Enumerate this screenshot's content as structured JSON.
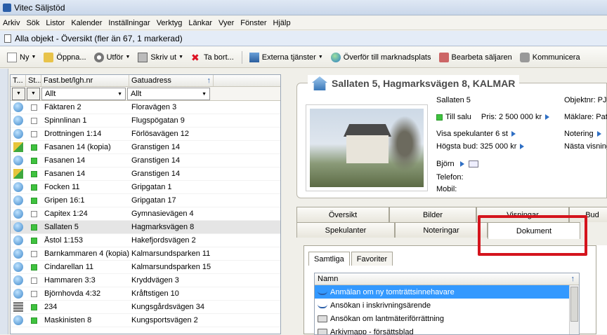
{
  "window": {
    "title": "Vitec Säljstöd"
  },
  "menu": [
    "Arkiv",
    "Sök",
    "Listor",
    "Kalender",
    "Inställningar",
    "Verktyg",
    "Länkar",
    "Vyer",
    "Fönster",
    "Hjälp"
  ],
  "object_bar": {
    "title": "Alla objekt - Översikt (fler än 67, 1 markerad)"
  },
  "toolbar": {
    "new": "Ny",
    "open": "Öppna...",
    "perform": "Utför",
    "print": "Skriv ut",
    "delete": "Ta bort...",
    "external": "Externa tjänster",
    "transfer": "Överför till marknadsplats",
    "edit_seller": "Bearbeta säljaren",
    "communicate": "Kommunicera"
  },
  "grid": {
    "headers": [
      "T...",
      "St...",
      "Fast.bet/lgh.nr",
      "Gatuadress"
    ],
    "filter_all": "Allt",
    "filter_all2": "Allt",
    "rows": [
      {
        "name": "Fäktaren 2",
        "addr": "Floravägen 3",
        "icon": "globe",
        "status": "none"
      },
      {
        "name": "Spinnlinan 1",
        "addr": "Flugspögatan 9",
        "icon": "globe",
        "status": "none"
      },
      {
        "name": "Drottningen 1:14",
        "addr": "Förlösavägen 12",
        "icon": "globe",
        "status": "none"
      },
      {
        "name": "Fasanen 14 (kopia)",
        "addr": "Granstigen 14",
        "icon": "alt",
        "status": "green"
      },
      {
        "name": "Fasanen 14",
        "addr": "Granstigen 14",
        "icon": "globe",
        "status": "green"
      },
      {
        "name": "Fasanen 14",
        "addr": "Granstigen 14",
        "icon": "alt",
        "status": "green"
      },
      {
        "name": "Focken 11",
        "addr": "Gripgatan 1",
        "icon": "globe",
        "status": "green"
      },
      {
        "name": "Gripen 16:1",
        "addr": "Gripgatan 17",
        "icon": "globe",
        "status": "green"
      },
      {
        "name": "Capitex 1:24",
        "addr": "Gymnasievägen 4",
        "icon": "globe",
        "status": "none"
      },
      {
        "name": "Sallaten 5",
        "addr": "Hagmarksvägen 8",
        "icon": "globe",
        "status": "green",
        "selected": true
      },
      {
        "name": "Åstol 1:153",
        "addr": "Hakefjordsvägen 2",
        "icon": "globe",
        "status": "green"
      },
      {
        "name": "Barnkammaren 4 (kopia)",
        "addr": "Kalmarsundsparken 11",
        "icon": "globe",
        "status": "none"
      },
      {
        "name": "Cindarellan 11",
        "addr": "Kalmarsundsparken 15",
        "icon": "globe",
        "status": "green"
      },
      {
        "name": "Hammaren 3:3",
        "addr": "Kryddvägen 3",
        "icon": "globe",
        "status": "none"
      },
      {
        "name": "Björnhovda 4:32",
        "addr": "Kråftstigen 10",
        "icon": "globe",
        "status": "none"
      },
      {
        "name": "234",
        "addr": "Kungsgårdsvägen 34",
        "icon": "bld",
        "status": "green"
      },
      {
        "name": "Maskinisten 8",
        "addr": "Kungsportsvägen 2",
        "icon": "globe",
        "status": "green"
      }
    ]
  },
  "detail": {
    "title": "Sallaten 5, Hagmarksvägen 8, KALMAR",
    "name": "Sallaten 5",
    "objnr": "Objektnr: PJ-",
    "status": "Till salu",
    "price": "Pris: 2 500 000 kr",
    "broker": "Mäklare: Patr",
    "speculants": "Visa spekulanter  6 st",
    "note": "Notering",
    "highest_bid": "Högsta bud: 325 000 kr",
    "next_viewing": "Nästa visning",
    "contact_name": "Björn",
    "phone_label": "Telefon:",
    "mobile_label": "Mobil:"
  },
  "tabs_top": [
    "Översikt",
    "Bilder",
    "Visningar",
    "Bud"
  ],
  "tabs_bottom": [
    "Spekulanter",
    "Noteringar",
    "Dokument"
  ],
  "doc_tabs": [
    "Samtliga",
    "Favoriter"
  ],
  "doc_grid": {
    "header": "Namn",
    "rows": [
      {
        "name": "Anmälan om ny tomträttsinnehavare",
        "icon": "wave",
        "selected": true
      },
      {
        "name": "Ansökan i inskrivningsärende",
        "icon": "wave"
      },
      {
        "name": "Ansökan om lantmäteriförrättning",
        "icon": "printer"
      },
      {
        "name": "Arkivmapp - försättsblad",
        "icon": "printer"
      }
    ]
  },
  "colors": {
    "highlight": "#3399ff",
    "annotation": "#d4141d",
    "status_green": "#3fc23f"
  }
}
